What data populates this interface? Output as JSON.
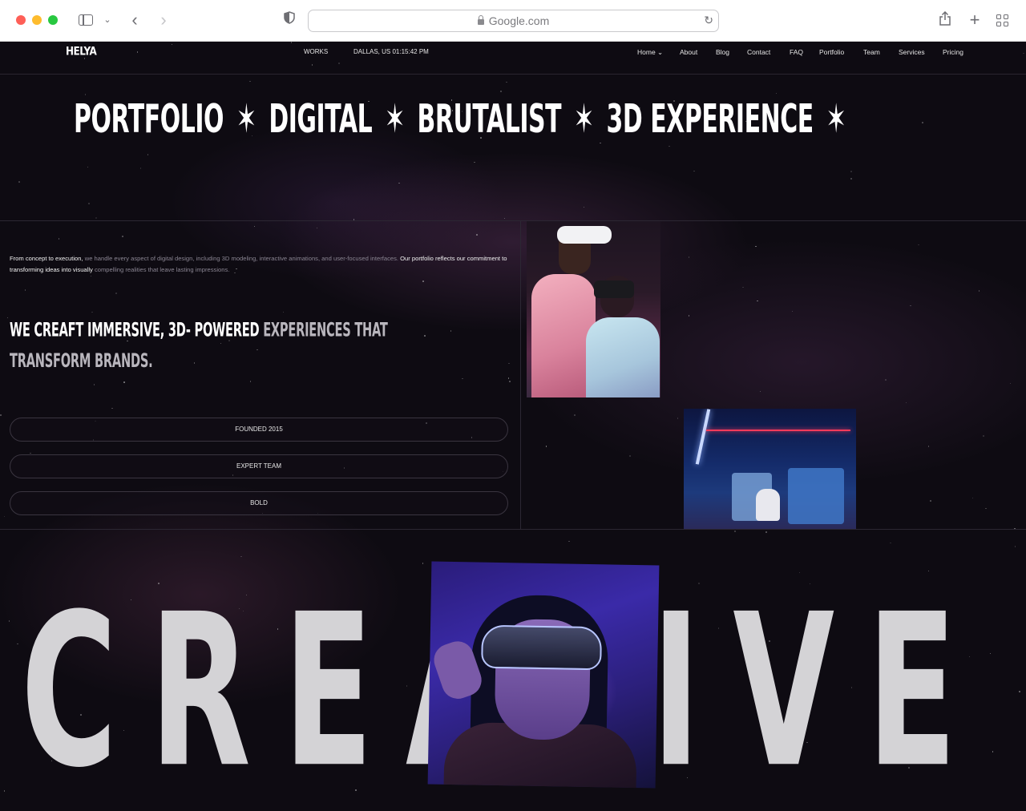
{
  "browser": {
    "url": "Google.com",
    "icons": [
      "sidebar-icon",
      "chevron-down-icon",
      "back-icon",
      "forward-icon",
      "shield-icon",
      "lock-icon",
      "reload-icon",
      "share-icon",
      "plus-icon",
      "tabs-grid-icon"
    ]
  },
  "site": {
    "logo": "HELYA",
    "works_label": "WORKS",
    "location_clock": "DALLAS, US 01:15:42 PM",
    "menu": [
      {
        "label": "Home ⌄"
      },
      {
        "label": "About"
      },
      {
        "label": "Blog"
      },
      {
        "label": "Contact"
      },
      {
        "label": "FAQ"
      },
      {
        "label": "Portfolio"
      },
      {
        "label": "Team"
      },
      {
        "label": "Services"
      },
      {
        "label": "Pricing"
      }
    ]
  },
  "marquee": {
    "items": [
      "PORTFOLIO",
      "DIGITAL",
      "BRUTALIST",
      "3D EXPERIENCE"
    ],
    "separator": "✶"
  },
  "intro": {
    "line1_white_a": "From concept to execution,",
    "line1_grey": " we handle every aspect of digital design, including 3D modeling, interactive animations, and user-focused interfaces.",
    "line1_white_b": " Our portfolio reflects our commitment to transforming ideas into visually",
    "line2_grey": " compelling realities that leave lasting impressions."
  },
  "headline": {
    "white": "WE CREAFT IMMERSIVE, 3D- POWERED",
    "grey": " EXPERIENCES THAT TRANSFORM BRANDS."
  },
  "pills": [
    "FOUNDED 2015",
    "EXPERT TEAM",
    "BOLD"
  ],
  "creative": {
    "word": "CREATIVE"
  },
  "colors": {
    "background": "#0e0b12",
    "text_white": "#ffffff",
    "text_grey": "#8a8592",
    "creative_text": "#d4d3d6"
  }
}
